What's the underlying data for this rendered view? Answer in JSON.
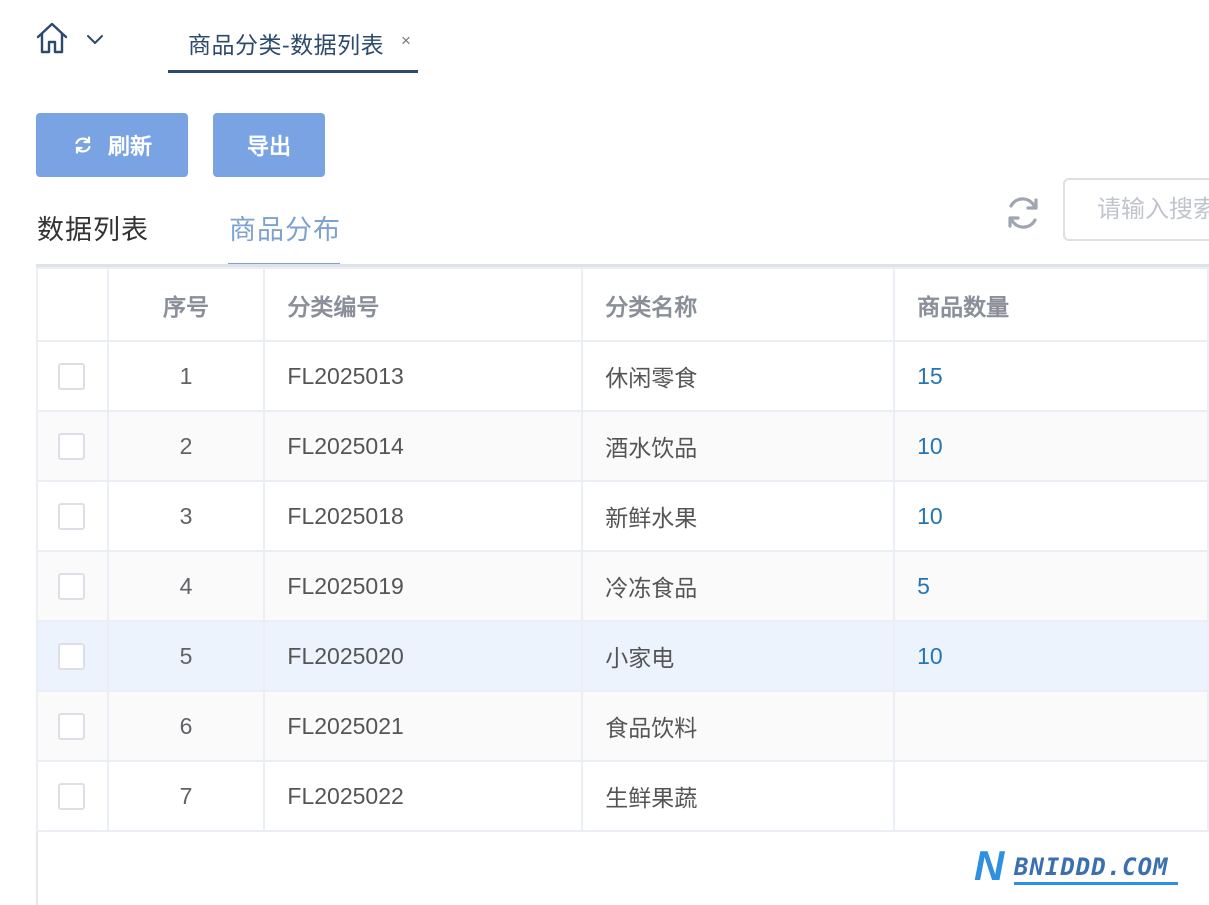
{
  "top_tabs": {
    "active_tab_label": "商品分类-数据列表",
    "close_glyph": "×",
    "home_icon": "home-icon",
    "dropdown_icon": "chevron-down-icon"
  },
  "toolbar": {
    "refresh_label": "刷新",
    "refresh_icon": "refresh-icon",
    "export_label": "导出"
  },
  "view_tabs": {
    "list_label": "数据列表",
    "distribution_label": "商品分布",
    "active": "商品分布"
  },
  "search": {
    "placeholder": "请输入搜索"
  },
  "table": {
    "headers": {
      "index": "序号",
      "code": "分类编号",
      "name": "分类名称",
      "count": "商品数量"
    },
    "rows": [
      {
        "index": "1",
        "code": "FL2025013",
        "name": "休闲零食",
        "count": "15"
      },
      {
        "index": "2",
        "code": "FL2025014",
        "name": "酒水饮品",
        "count": "10"
      },
      {
        "index": "3",
        "code": "FL2025018",
        "name": "新鲜水果",
        "count": "10"
      },
      {
        "index": "4",
        "code": "FL2025019",
        "name": "冷冻食品",
        "count": "5"
      },
      {
        "index": "5",
        "code": "FL2025020",
        "name": "小家电",
        "count": "10"
      },
      {
        "index": "6",
        "code": "FL2025021",
        "name": "食品饮料",
        "count": ""
      },
      {
        "index": "7",
        "code": "FL2025022",
        "name": "生鲜果蔬",
        "count": ""
      }
    ]
  },
  "colors": {
    "primary_button": "#79a3e3",
    "active_tab": "#7ea2cf",
    "count_link": "#2576b0",
    "highlight_row": "#ecf3fd"
  },
  "watermark": {
    "letter": "N",
    "text": "BNIDDD.COM"
  }
}
